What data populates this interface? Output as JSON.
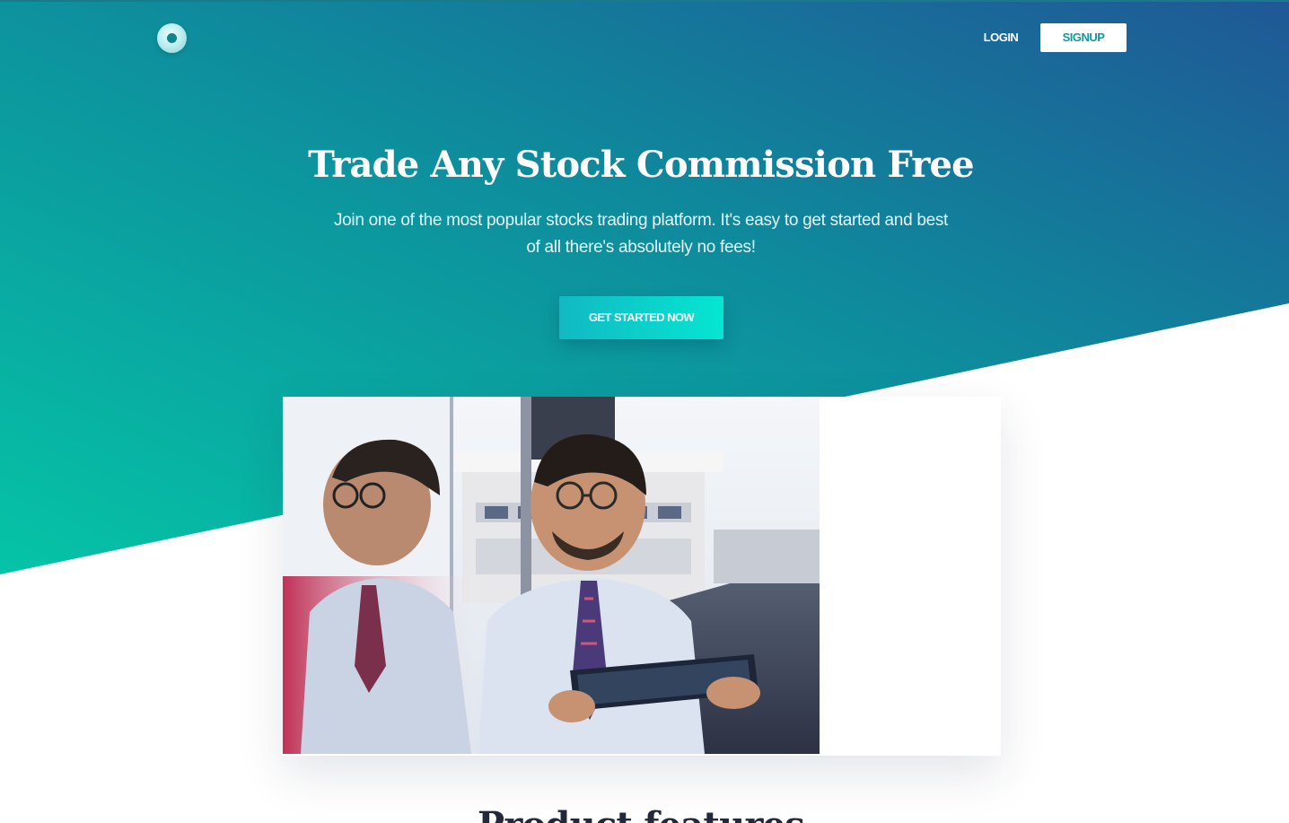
{
  "colors": {
    "gradient_start": "#05c4a6",
    "gradient_mid": "#0e8d9d",
    "gradient_end": "#1f5896",
    "cta_start": "#12b9c3",
    "cta_end": "#05e6d2",
    "signup_text": "#0f9aa4",
    "heading_dark": "#23293a"
  },
  "header": {
    "logo_icon": "circle-logo-icon",
    "login_label": "LOGIN",
    "signup_label": "SIGNUP"
  },
  "hero": {
    "title": "Trade Any Stock Commission Free",
    "subtitle": "Join one of the most popular stocks trading platform. It's easy to get started and best of all there's absolutely no fees!",
    "cta_label": "GET STARTED NOW"
  },
  "showcase": {
    "image": "businessman-with-tablet-photo"
  },
  "features": {
    "title": "Product features"
  }
}
